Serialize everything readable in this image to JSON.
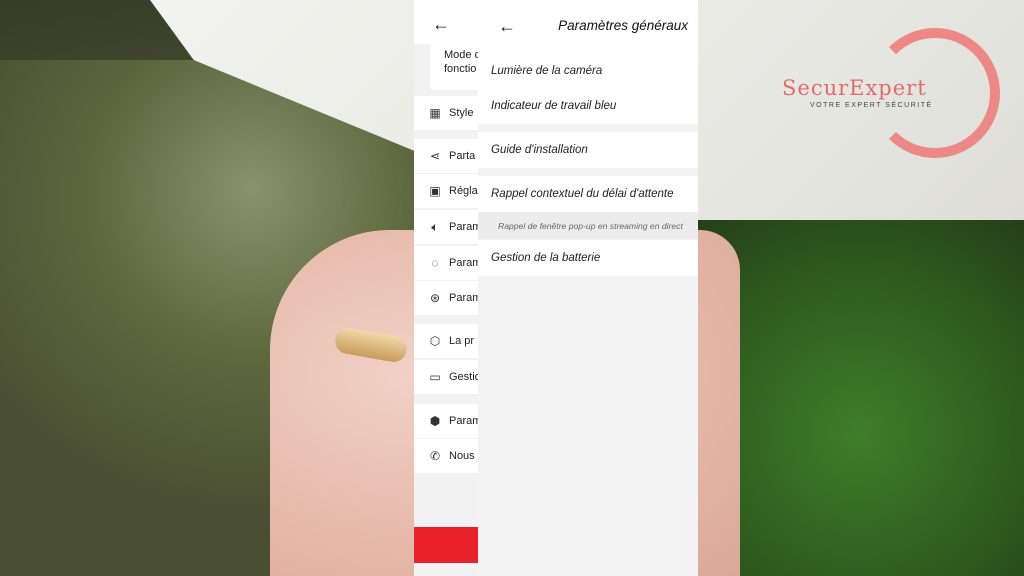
{
  "logo": {
    "text": "SecurExpert",
    "tagline": "VOTRE EXPERT SÉCURITÉ"
  },
  "back_screen": {
    "mode_text": "Mode d fonctio",
    "items": [
      {
        "label": "Style",
        "icon": "grid-icon"
      },
      {
        "label": "Parta",
        "icon": "share-icon"
      },
      {
        "label": "Régla",
        "icon": "image-icon"
      },
      {
        "label": "Param",
        "icon": "speaker-icon"
      },
      {
        "label": "Param",
        "icon": "bulb-icon"
      },
      {
        "label": "Param",
        "icon": "camera-settings-icon"
      },
      {
        "label": "La pr",
        "icon": "shield-icon"
      },
      {
        "label": "Gestic",
        "icon": "video-icon"
      },
      {
        "label": "Param",
        "icon": "hexagon-icon"
      },
      {
        "label": "Nous",
        "icon": "phone-icon"
      }
    ]
  },
  "screen": {
    "title": "Paramètres généraux",
    "rows": {
      "camera_light": "Lumière de la caméra",
      "blue_indicator": "Indicateur de travail bleu",
      "install_guide": "Guide d'installation",
      "popup_reminder": "Rappel contextuel du délai d'attente",
      "popup_reminder_desc": "Rappel de fenêtre pop-up en streaming en direct",
      "battery": "Gestion de la batterie"
    }
  }
}
